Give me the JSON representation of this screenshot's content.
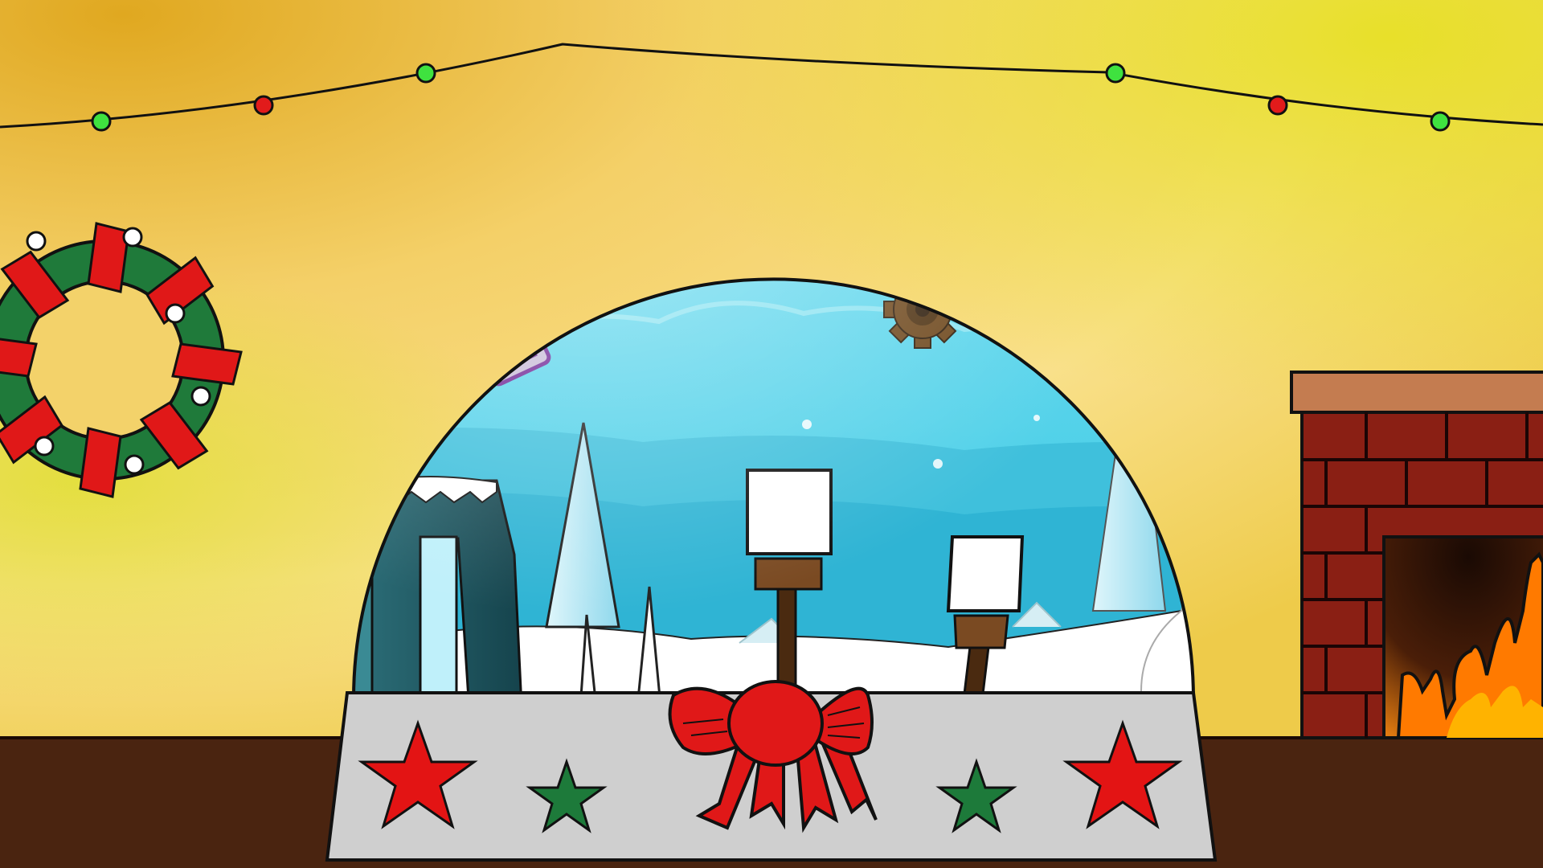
{
  "scene": {
    "type": "game-menu-background",
    "theme": "christmas-snow-globe",
    "colors": {
      "wall_light": "#f7dc78",
      "wall_mid": "#efc24a",
      "wall_dark": "#e0a820",
      "floor": "#4a2410",
      "light_red": "#e21b1b",
      "light_green": "#3fe23f",
      "wreath_green": "#1f7a3a",
      "ribbon_red": "#e01818",
      "brick": "#8a1f14",
      "mantel": "#c47c50",
      "fire_orange": "#ff7a00",
      "glass_blue": "#7fd8ea",
      "sky_blue": "#aee8f4",
      "base_grey": "#cfcfcf",
      "star_red": "#e31414",
      "star_green": "#1d7a3a",
      "gear_brown": "#6b4418",
      "player_purple": "#b04ad8"
    },
    "elements": [
      "string-lights",
      "wreath",
      "fireplace",
      "snow-globe",
      "gear-obstacle",
      "player-cube",
      "jump-orb",
      "ice-spikes",
      "block-pillar",
      "signposts",
      "bow",
      "stars"
    ]
  }
}
